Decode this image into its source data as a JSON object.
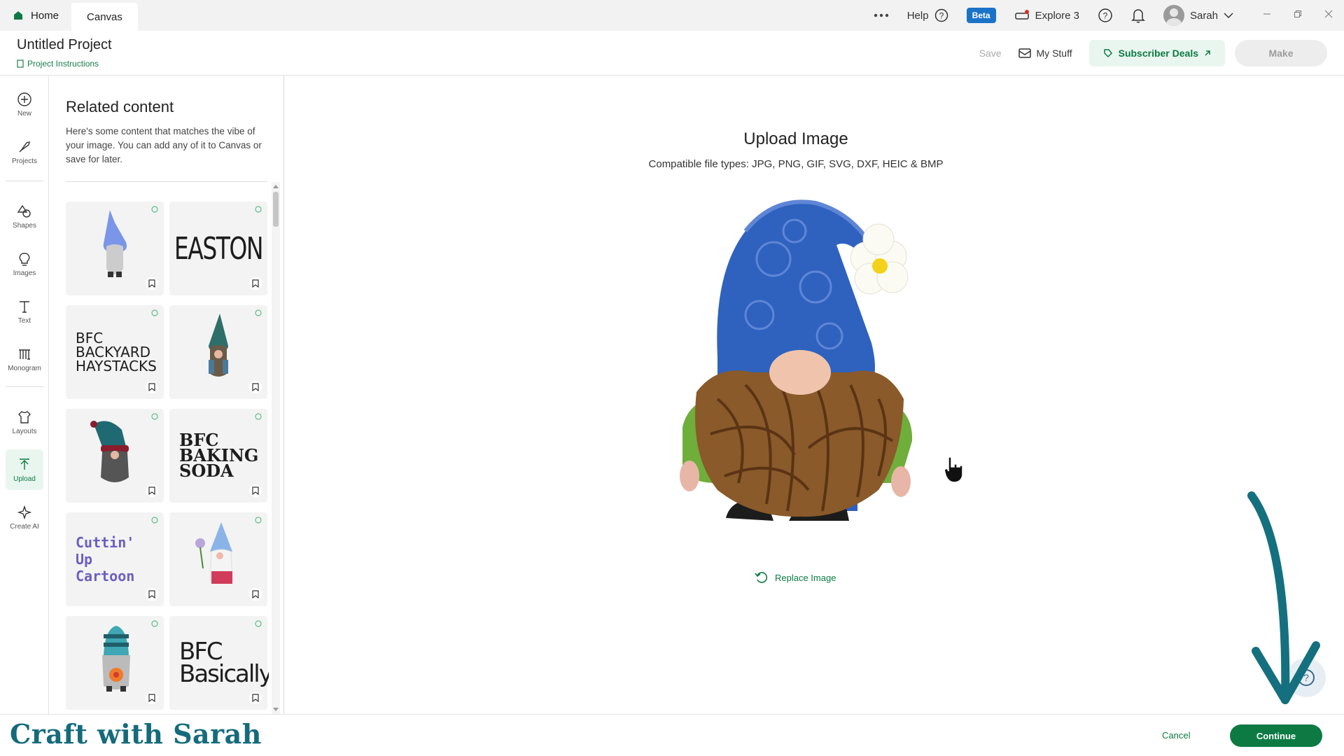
{
  "tabs": {
    "home": "Home",
    "canvas": "Canvas"
  },
  "topbar": {
    "help": "Help",
    "beta": "Beta",
    "explore": "Explore 3",
    "user": "Sarah",
    "more_icon": "ellipsis-icon"
  },
  "header": {
    "title": "Untitled Project",
    "instructions": "Project Instructions",
    "save": "Save",
    "my_stuff": "My Stuff",
    "subscriber_deals": "Subscriber Deals",
    "make": "Make"
  },
  "rail": {
    "new": "New",
    "projects": "Projects",
    "shapes": "Shapes",
    "images": "Images",
    "text": "Text",
    "monogram": "Monogram",
    "layouts": "Layouts",
    "upload": "Upload",
    "create_ai": "Create AI"
  },
  "panel": {
    "title": "Related content",
    "description": "Here's some content that matches the vibe of your image. You can add any of it to Canvas or save for later.",
    "fonts": {
      "easton": "EASTON",
      "backyard": "BFC BACKYARD HAYSTACKS",
      "baking": "BFC BAKING SODA",
      "cuttin": "Cuttin' Up Cartoon",
      "basically": "BFC Basically"
    }
  },
  "main": {
    "title": "Upload Image",
    "subtitle": "Compatible file types:  JPG, PNG, GIF, SVG, DXF, HEIC & BMP",
    "replace": "Replace Image"
  },
  "footer": {
    "brand": "Craft with Sarah",
    "cancel": "Cancel",
    "continue": "Continue"
  },
  "colors": {
    "accent": "#0d7a44",
    "beta": "#1a73c8",
    "brand": "#146b7c"
  }
}
